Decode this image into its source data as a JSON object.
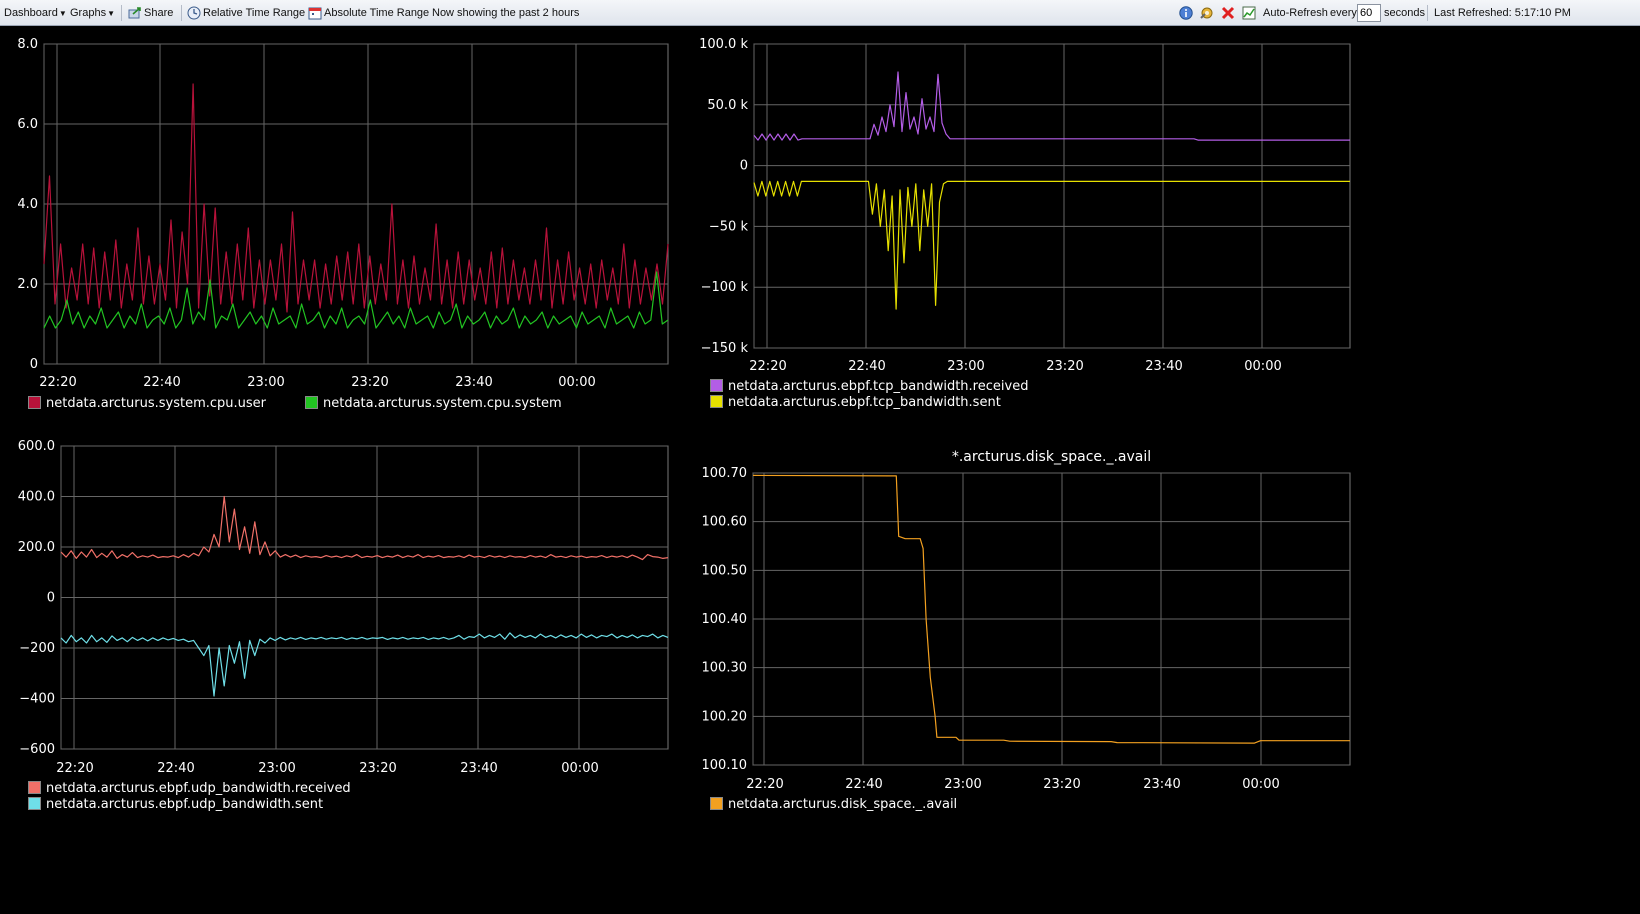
{
  "toolbar": {
    "dashboard_label": "Dashboard",
    "graphs_label": "Graphs",
    "share_label": "Share",
    "relative_label": "Relative Time Range",
    "absolute_label": "Absolute Time Range",
    "status_text": "Now showing the past 2 hours",
    "auto_refresh_label": "Auto-Refresh",
    "every_label": "every",
    "every_value": "60",
    "seconds_label": "seconds",
    "last_refreshed": "Last Refreshed: 5:17:10 PM"
  },
  "chart_data": [
    {
      "type": "line",
      "title": "",
      "x_ticks": [
        "22:20",
        "22:40",
        "23:00",
        "23:20",
        "23:40",
        "00:00"
      ],
      "y_ticks": [
        "8.0",
        "6.0",
        "4.0",
        "2.0",
        "0"
      ],
      "ylim": [
        0,
        8
      ],
      "series": [
        {
          "name": "netdata.arcturus.system.cpu.user",
          "color": "#b8123a",
          "values": [
            2.5,
            4.7,
            1.5,
            3.0,
            1.4,
            2.4,
            1.6,
            3.0,
            1.5,
            2.9,
            1.4,
            2.8,
            1.6,
            3.1,
            1.4,
            2.5,
            1.6,
            3.4,
            1.5,
            2.7,
            1.5,
            2.5,
            1.6,
            3.6,
            1.4,
            3.3,
            2.0,
            7.0,
            1.4,
            4.0,
            1.7,
            3.9,
            1.5,
            2.8,
            1.5,
            3.0,
            1.6,
            3.4,
            1.4,
            2.6,
            1.5,
            2.6,
            1.6,
            3.0,
            1.3,
            3.8,
            1.5,
            2.6,
            1.6,
            2.6,
            1.4,
            2.5,
            1.5,
            2.7,
            1.6,
            2.8,
            1.5,
            3.0,
            1.4,
            2.7,
            1.5,
            2.5,
            1.6,
            4.0,
            1.5,
            2.6,
            1.4,
            2.7,
            1.5,
            2.4,
            1.6,
            3.5,
            1.5,
            2.6,
            1.4,
            2.8,
            1.5,
            2.6,
            1.6,
            2.4,
            1.5,
            2.8,
            1.4,
            2.9,
            1.5,
            2.6,
            1.6,
            2.4,
            1.5,
            2.6,
            1.6,
            3.4,
            1.4,
            2.6,
            1.5,
            2.8,
            1.6,
            2.4,
            1.5,
            2.5,
            1.4,
            2.6,
            1.6,
            2.4,
            1.5,
            3.0,
            1.4,
            2.6,
            1.5,
            2.4,
            1.6,
            2.5,
            1.5,
            3.0
          ]
        },
        {
          "name": "netdata.arcturus.system.cpu.system",
          "color": "#22c322",
          "values": [
            0.9,
            1.2,
            0.9,
            1.1,
            1.6,
            1.0,
            1.3,
            0.9,
            1.2,
            1.0,
            1.4,
            0.9,
            1.1,
            1.3,
            0.9,
            1.2,
            1.0,
            1.5,
            0.9,
            1.1,
            1.2,
            1.0,
            1.4,
            0.9,
            1.1,
            1.9,
            1.0,
            1.3,
            1.1,
            2.1,
            0.9,
            1.2,
            1.1,
            1.5,
            0.9,
            1.1,
            1.3,
            1.0,
            1.2,
            0.9,
            1.4,
            1.0,
            1.1,
            1.2,
            0.9,
            1.5,
            1.0,
            1.1,
            1.3,
            0.9,
            1.2,
            1.0,
            1.4,
            0.9,
            1.1,
            1.2,
            1.0,
            1.6,
            0.9,
            1.1,
            1.3,
            1.0,
            1.2,
            0.9,
            1.4,
            1.0,
            1.1,
            1.2,
            0.9,
            1.3,
            1.0,
            1.1,
            1.5,
            0.9,
            1.2,
            1.0,
            1.1,
            1.3,
            0.9,
            1.2,
            1.0,
            1.1,
            1.4,
            0.9,
            1.2,
            1.0,
            1.1,
            1.3,
            0.9,
            1.2,
            1.0,
            1.1,
            1.2,
            0.9,
            1.3,
            1.0,
            1.1,
            1.2,
            0.9,
            1.4,
            1.0,
            1.1,
            1.2,
            0.9,
            1.3,
            1.0,
            1.1,
            2.3,
            1.0,
            1.1
          ]
        }
      ]
    },
    {
      "type": "line",
      "title": "",
      "x_ticks": [
        "22:20",
        "22:40",
        "23:00",
        "23:20",
        "23:40",
        "00:00"
      ],
      "y_ticks": [
        "100.0 k",
        "50.0 k",
        "0",
        "−50 k",
        "−100 k",
        "−150 k"
      ],
      "ylim": [
        -150000,
        100000
      ],
      "series": [
        {
          "name": "netdata.arcturus.ebpf.tcp_bandwidth.received",
          "color": "#b35de6",
          "values": [
            25000,
            21000,
            26000,
            21000,
            26000,
            21000,
            26000,
            21000,
            26000,
            21000,
            26000,
            21000,
            22000,
            22000,
            22000,
            22000,
            22000,
            22000,
            22000,
            22000,
            22000,
            22000,
            22000,
            22000,
            22000,
            22000,
            22000,
            22000,
            22000,
            22000,
            34000,
            25000,
            40000,
            28000,
            50000,
            32000,
            77000,
            28000,
            60000,
            30000,
            40000,
            26000,
            55000,
            30000,
            40000,
            28000,
            75000,
            35000,
            26000,
            22000,
            22000,
            22000,
            22000,
            22000,
            22000,
            22000,
            22000,
            22000,
            22000,
            22000,
            22000,
            22000,
            22000,
            22000,
            22000,
            22000,
            22000,
            22000,
            22000,
            22000,
            22000,
            22000,
            22000,
            22000,
            22000,
            22000,
            22000,
            22000,
            22000,
            22000,
            22000,
            22000,
            22000,
            22000,
            22000,
            22000,
            22000,
            22000,
            22000,
            22000,
            22000,
            22000,
            22000,
            22000,
            22000,
            22000,
            22000,
            22000,
            22000,
            22000,
            22000,
            22000,
            22000,
            22000,
            22000,
            22000,
            22000,
            22000,
            22000,
            22000,
            22000,
            21000,
            21000,
            21000,
            21000,
            21000,
            21000,
            21000,
            21000,
            21000,
            21000,
            21000,
            21000,
            21000,
            21000,
            21000,
            21000,
            21000,
            21000,
            21000,
            21000,
            21000,
            21000,
            21000,
            21000,
            21000,
            21000,
            21000,
            21000,
            21000,
            21000,
            21000,
            21000,
            21000,
            21000,
            21000,
            21000,
            21000,
            21000,
            21000
          ]
        },
        {
          "name": "netdata.arcturus.ebpf.tcp_bandwidth.sent",
          "color": "#e6e000",
          "values": [
            -14000,
            -25000,
            -13000,
            -25000,
            -13000,
            -25000,
            -13000,
            -25000,
            -13000,
            -25000,
            -13000,
            -25000,
            -13000,
            -13000,
            -13000,
            -13000,
            -13000,
            -13000,
            -13000,
            -13000,
            -13000,
            -13000,
            -13000,
            -13000,
            -13000,
            -13000,
            -13000,
            -13000,
            -13000,
            -13000,
            -40000,
            -15000,
            -50000,
            -20000,
            -70000,
            -25000,
            -118000,
            -20000,
            -80000,
            -18000,
            -50000,
            -15000,
            -70000,
            -20000,
            -50000,
            -15000,
            -115000,
            -30000,
            -15000,
            -13000,
            -13000,
            -13000,
            -13000,
            -13000,
            -13000,
            -13000,
            -13000,
            -13000,
            -13000,
            -13000,
            -13000,
            -13000,
            -13000,
            -13000,
            -13000,
            -13000,
            -13000,
            -13000,
            -13000,
            -13000,
            -13000,
            -13000,
            -13000,
            -13000,
            -13000,
            -13000,
            -13000,
            -13000,
            -13000,
            -13000,
            -13000,
            -13000,
            -13000,
            -13000,
            -13000,
            -13000,
            -13000,
            -13000,
            -13000,
            -13000,
            -13000,
            -13000,
            -13000,
            -13000,
            -13000,
            -13000,
            -13000,
            -13000,
            -13000,
            -13000,
            -13000,
            -13000,
            -13000,
            -13000,
            -13000,
            -13000,
            -13000,
            -13000,
            -13000,
            -13000,
            -13000,
            -13000,
            -13000,
            -13000,
            -13000,
            -13000,
            -13000,
            -13000,
            -13000,
            -13000,
            -13000,
            -13000,
            -13000,
            -13000,
            -13000,
            -13000,
            -13000,
            -13000,
            -13000,
            -13000,
            -13000,
            -13000,
            -13000,
            -13000,
            -13000,
            -13000,
            -13000,
            -13000,
            -13000,
            -13000,
            -13000,
            -13000,
            -13000,
            -13000,
            -13000,
            -13000,
            -13000,
            -13000,
            -13000,
            -13000,
            -13000,
            -13000
          ]
        }
      ]
    },
    {
      "type": "line",
      "title": "",
      "x_ticks": [
        "22:20",
        "22:40",
        "23:00",
        "23:20",
        "23:40",
        "00:00"
      ],
      "y_ticks": [
        "600.0",
        "400.0",
        "200.0",
        "0",
        "−200",
        "−400",
        "−600"
      ],
      "ylim": [
        -600,
        600
      ],
      "series": [
        {
          "name": "netdata.arcturus.ebpf.udp_bandwidth.received",
          "color": "#f07068",
          "values": [
            180,
            160,
            185,
            155,
            180,
            160,
            190,
            158,
            175,
            160,
            185,
            155,
            170,
            160,
            178,
            158,
            165,
            160,
            168,
            158,
            162,
            160,
            165,
            158,
            170,
            160,
            175,
            165,
            200,
            180,
            250,
            200,
            400,
            220,
            350,
            190,
            280,
            175,
            300,
            170,
            220,
            165,
            185,
            160,
            170,
            160,
            168,
            158,
            165,
            160,
            162,
            158,
            166,
            160,
            164,
            158,
            165,
            160,
            170,
            158,
            163,
            160,
            166,
            158,
            164,
            160,
            168,
            158,
            165,
            160,
            170,
            158,
            164,
            160,
            166,
            158,
            162,
            160,
            165,
            158,
            168,
            160,
            163,
            158,
            166,
            160,
            164,
            158,
            165,
            160,
            162,
            158,
            166,
            160,
            164,
            158,
            170,
            160,
            163,
            158,
            165,
            160,
            164,
            158,
            162,
            160,
            166,
            158,
            164,
            160,
            165,
            158,
            168,
            160,
            150,
            170,
            162,
            160,
            155,
            158
          ]
        },
        {
          "name": "netdata.arcturus.ebpf.udp_bandwidth.sent",
          "color": "#6fdfe8",
          "values": [
            -160,
            -180,
            -150,
            -175,
            -160,
            -180,
            -150,
            -175,
            -160,
            -178,
            -152,
            -170,
            -160,
            -175,
            -158,
            -170,
            -160,
            -172,
            -160,
            -170,
            -160,
            -168,
            -162,
            -170,
            -165,
            -175,
            -170,
            -200,
            -230,
            -190,
            -390,
            -200,
            -350,
            -190,
            -260,
            -175,
            -320,
            -170,
            -230,
            -165,
            -180,
            -160,
            -170,
            -158,
            -168,
            -160,
            -165,
            -158,
            -166,
            -160,
            -164,
            -158,
            -165,
            -160,
            -163,
            -158,
            -166,
            -160,
            -164,
            -158,
            -165,
            -160,
            -162,
            -158,
            -166,
            -160,
            -164,
            -158,
            -165,
            -160,
            -163,
            -158,
            -166,
            -160,
            -164,
            -158,
            -165,
            -160,
            -150,
            -165,
            -155,
            -158,
            -145,
            -160,
            -150,
            -158,
            -145,
            -165,
            -140,
            -160,
            -148,
            -158,
            -150,
            -160,
            -145,
            -158,
            -150,
            -160,
            -148,
            -158,
            -150,
            -160,
            -145,
            -158,
            -148,
            -160,
            -150,
            -155,
            -145,
            -160,
            -150,
            -158,
            -148,
            -160,
            -150,
            -155,
            -145,
            -160,
            -150,
            -158
          ]
        }
      ]
    },
    {
      "type": "line",
      "title": "*.arcturus.disk_space._.avail",
      "x_ticks": [
        "22:20",
        "22:40",
        "23:00",
        "23:20",
        "23:40",
        "00:00"
      ],
      "y_ticks": [
        "100.70",
        "100.60",
        "100.50",
        "100.40",
        "100.30",
        "100.20",
        "100.10"
      ],
      "ylim": [
        100.1,
        100.7
      ],
      "series": [
        {
          "name": "netdata.arcturus.disk_space._.avail",
          "color": "#f2a020",
          "points": [
            [
              0,
              100.695
            ],
            [
              0.24,
              100.694
            ],
            [
              0.235,
              100.694
            ],
            [
              0.24,
              100.694
            ],
            [
              0.244,
              100.57
            ],
            [
              0.255,
              100.565
            ],
            [
              0.28,
              100.565
            ],
            [
              0.285,
              100.545
            ],
            [
              0.29,
              100.4
            ],
            [
              0.297,
              100.28
            ],
            [
              0.305,
              100.2
            ],
            [
              0.308,
              100.157
            ],
            [
              0.34,
              100.157
            ],
            [
              0.345,
              100.151
            ],
            [
              0.42,
              100.151
            ],
            [
              0.43,
              100.149
            ],
            [
              0.6,
              100.148
            ],
            [
              0.61,
              100.146
            ],
            [
              0.84,
              100.145
            ],
            [
              0.85,
              100.15
            ],
            [
              1.0,
              100.15
            ]
          ]
        }
      ]
    }
  ]
}
